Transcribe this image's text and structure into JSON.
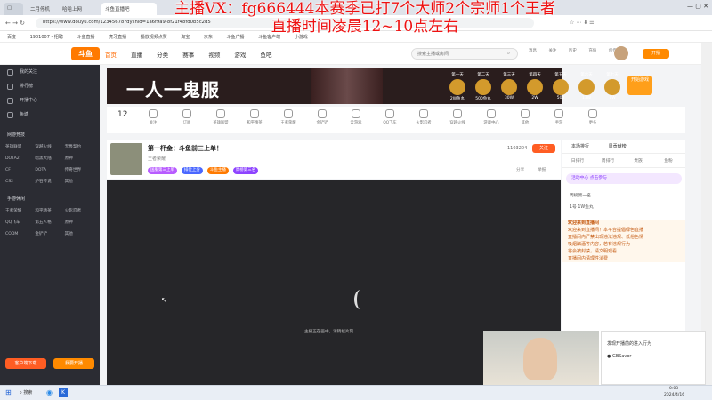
{
  "browser": {
    "tabs": [
      "二月停机",
      "哈哈上网",
      "斗鱼直播吧"
    ],
    "url": "https://www.douyu.com/12345678?dyshid=1a6f9a9-8f21f48fd0b5c2d5"
  },
  "overlay": {
    "line1": "主播VX：fg666444本赛季已打7个大师2个宗师1个王者",
    "line2": "直播时间凌晨12~10点左右"
  },
  "bookmarks": [
    "百度",
    "1901007 - 招聘",
    "斗鱼直播",
    "虎牙直播",
    "播放视频点赞",
    "淘宝",
    "京东",
    "斗鱼广播",
    "斗鱼客户端",
    "小游戏"
  ],
  "site": {
    "logo": "斗鱼",
    "nav": [
      "首页",
      "直播",
      "分类",
      "赛事",
      "视频",
      "游戏",
      "鱼吧"
    ],
    "search_placeholder": "搜索主播或房间",
    "right_icons": [
      "消息",
      "关注",
      "历史",
      "充值",
      "创作"
    ],
    "open_button": "开播"
  },
  "sidebar": {
    "top_items": [
      "我的关注",
      "排行榜",
      "开播中心",
      "鱼塘"
    ],
    "sec1": "网游竞技",
    "sec1_items": [
      "英雄联盟",
      "穿越火线",
      "无畏契约",
      "DOTA2",
      "暗黑大陆",
      "原神",
      "CF",
      "DOTA",
      "传奇世界",
      "CS2",
      "炉石传说",
      "其他"
    ],
    "sec2": "手游休闲",
    "sec2_items": [
      "王者荣耀",
      "和平精英",
      "火影忍者",
      "QQ飞车",
      "第五人格",
      "原神",
      "CODM",
      "金铲铲",
      "其他"
    ],
    "download_button": "客户端下载",
    "open_button": "我要开播"
  },
  "banner": {
    "title": "一人一鬼服",
    "gifts": [
      "第一天",
      "第二天",
      "第三天",
      "第四天",
      "第五天",
      "第六天",
      "第七天"
    ],
    "gift_values": [
      "2W鱼丸",
      "500鱼丸",
      "30W",
      "2W",
      "500",
      "13W",
      "1W"
    ],
    "game_button": "开始游戏"
  },
  "categories": {
    "count": "12",
    "items": [
      "关注",
      "订阅",
      "英雄联盟",
      "和平精英",
      "王者荣耀",
      "金铲铲",
      "云游戏",
      "QQ飞车",
      "火影忍者",
      "穿越火线",
      "游戏中心",
      "其他",
      "手游",
      "更多"
    ]
  },
  "room": {
    "title": "第一杯金：斗鱼前三上单！",
    "game": "王者荣耀",
    "tags": [
      "国服第三上单",
      "排位上分",
      "斗鱼主播",
      "周榜第三名"
    ],
    "follow_button": "关注",
    "fans": "1103204",
    "share": "分享",
    "report": "举报"
  },
  "player": {
    "loading_text": "主播正在画中，请稍候片刻"
  },
  "right_panel": {
    "top_tabs": [
      "本场排行",
      "周贡献榜"
    ],
    "tabs": [
      "日排行",
      "周排行",
      "贵族",
      "鱼粉"
    ],
    "banner_text": "活动中心 点击参与",
    "rows": [
      "周榜第一名",
      "1号 1W鱼丸"
    ],
    "chat_title": "欢迎来到直播间",
    "chat_lines": [
      "欢迎来到直播间！本平台提倡绿色直播",
      "直播间内严禁出现违法违规、低俗色情",
      "吸烟酗酒等内容，若有违规行为",
      "将会被封禁，请文明观看",
      "直播间内请理性消费"
    ]
  },
  "cam_notice": {
    "title": "发现开播前的进入行为",
    "item": "GBSavor"
  },
  "taskbar": {
    "search": "搜索",
    "time": "0:03",
    "date": "2024/4/16"
  }
}
